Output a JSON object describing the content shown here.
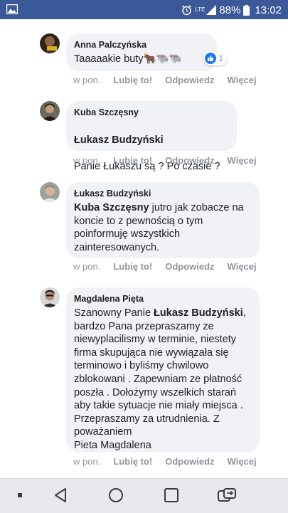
{
  "status_bar": {
    "network_label": "LTE",
    "battery": "88%",
    "time": "13:02"
  },
  "comments": [
    {
      "author": "Anna Palczyńska",
      "text": "Taaaaakie buty🐂🐃🐃",
      "reaction_count": "1",
      "time": "w pon.",
      "like": "Lubię to!",
      "reply": "Odpowiedz",
      "more": "Więcej"
    },
    {
      "author": "Kuba Szczęsny",
      "mention": "Łukasz Budzyński",
      "text": "Panie Łukaszu są ? Po czasie ?",
      "time": "w pon.",
      "like": "Lubię to!",
      "reply": "Odpowiedz",
      "more": "Więcej"
    },
    {
      "author": "Łukasz Budzyński",
      "mention": "Kuba Szczęsny",
      "text": " jutro jak zobacze na koncie to z pewnością o tym poinformuję wszystkich zainteresowanych.",
      "time": "w pon.",
      "like": "Lubię to!",
      "reply": "Odpowiedz",
      "more": "Więcej"
    },
    {
      "author": "Magdalena Pięta",
      "text_before": "Szanowny Panie ",
      "mention": "Łukasz Budzyński",
      "text": ", bardzo Pana przepraszamy ze niewyplacilismy w terminie, niestety firma skupująca nie wywiązała się terminowo i byliśmy chwilowo zblokowani . Zapewniam ze płatność poszła . Dołożymy wszelkich starań aby takie sytuacje nie miały miejsca . Przepraszamy za utrudnienia. Z poważaniem\nPieta Magdalena",
      "time": "w pon.",
      "like": "Lubię to!",
      "reply": "Odpowiedz",
      "more": "Więcej"
    }
  ],
  "colors": {
    "status_bar": "#3b5998",
    "bubble": "#f0f2f5",
    "meta": "#90949c",
    "like_blue": "#1877f2",
    "nav_bar": "#e8e9ed"
  }
}
